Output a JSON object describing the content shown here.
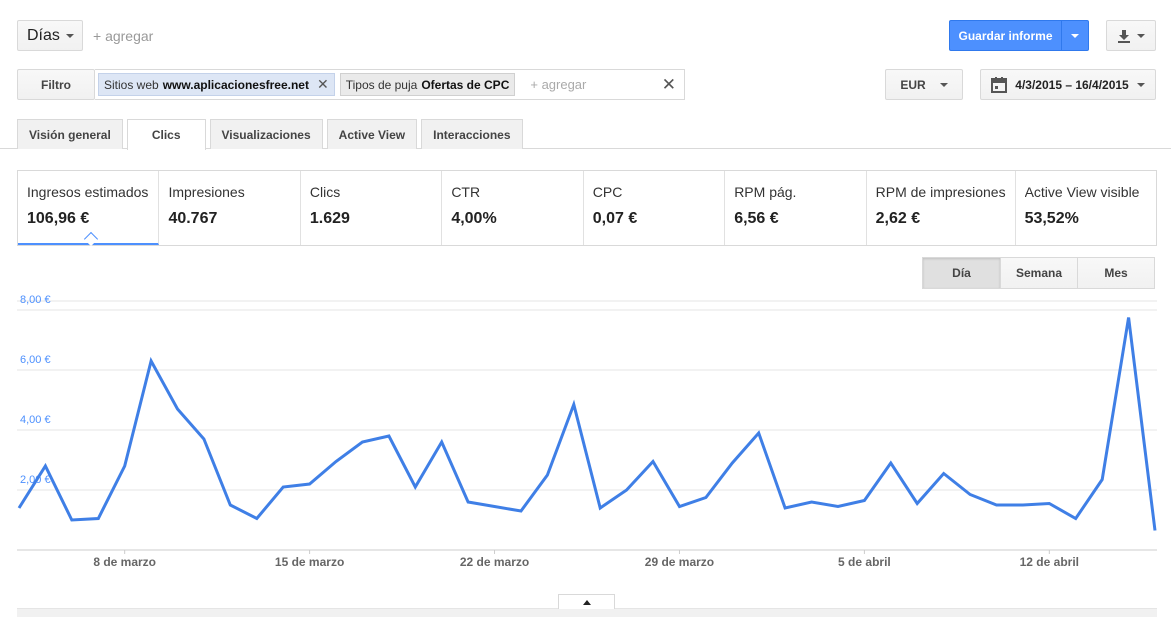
{
  "toolbar": {
    "period_label": "Días",
    "add_label": "+ agregar",
    "save_label": "Guardar informe"
  },
  "filters": {
    "filter_label": "Filtro",
    "chips": [
      {
        "key": "Sitios web",
        "value": "www.aplicacionesfree.net"
      },
      {
        "key": "Tipos de puja",
        "value": "Ofertas de CPC"
      }
    ],
    "add_label": "+ agregar",
    "currency": "EUR",
    "date_range": "4/3/2015 – 16/4/2015"
  },
  "tabs": [
    "Visión general",
    "Clics",
    "Visualizaciones",
    "Active View",
    "Interacciones"
  ],
  "metrics": [
    {
      "name": "Ingresos estimados",
      "value": "106,96 €"
    },
    {
      "name": "Impresiones",
      "value": "40.767"
    },
    {
      "name": "Clics",
      "value": "1.629"
    },
    {
      "name": "CTR",
      "value": "4,00%"
    },
    {
      "name": "CPC",
      "value": "0,07 €"
    },
    {
      "name": "RPM pág.",
      "value": "6,56 €"
    },
    {
      "name": "RPM de impresiones",
      "value": "2,62 €"
    },
    {
      "name": "Active View visible",
      "value": "53,52%"
    }
  ],
  "granularity": [
    "Día",
    "Semana",
    "Mes"
  ],
  "colors": {
    "accent": "#4d90fe",
    "line": "#3f7fe6"
  },
  "chart_data": {
    "type": "line",
    "x": [
      "2015-03-04",
      "2015-03-05",
      "2015-03-06",
      "2015-03-07",
      "2015-03-08",
      "2015-03-09",
      "2015-03-10",
      "2015-03-11",
      "2015-03-12",
      "2015-03-13",
      "2015-03-14",
      "2015-03-15",
      "2015-03-16",
      "2015-03-17",
      "2015-03-18",
      "2015-03-19",
      "2015-03-20",
      "2015-03-21",
      "2015-03-22",
      "2015-03-23",
      "2015-03-24",
      "2015-03-25",
      "2015-03-26",
      "2015-03-27",
      "2015-03-28",
      "2015-03-29",
      "2015-03-30",
      "2015-03-31",
      "2015-04-01",
      "2015-04-02",
      "2015-04-03",
      "2015-04-04",
      "2015-04-05",
      "2015-04-06",
      "2015-04-07",
      "2015-04-08",
      "2015-04-09",
      "2015-04-10",
      "2015-04-11",
      "2015-04-12",
      "2015-04-13",
      "2015-04-14",
      "2015-04-15",
      "2015-04-16"
    ],
    "series": [
      {
        "values": [
          1.4,
          2.8,
          1.0,
          1.05,
          2.8,
          6.3,
          4.7,
          3.7,
          1.5,
          1.05,
          2.1,
          2.2,
          2.95,
          3.6,
          3.8,
          2.1,
          3.6,
          1.6,
          1.45,
          1.3,
          2.5,
          4.85,
          1.4,
          2.0,
          2.95,
          1.45,
          1.75,
          2.9,
          3.9,
          1.4,
          1.6,
          1.45,
          1.65,
          2.9,
          1.55,
          2.55,
          1.85,
          1.5,
          1.5,
          1.55,
          1.05,
          2.35,
          7.75,
          0.65
        ]
      }
    ],
    "x_tick_labels": [
      "8 de marzo",
      "15 de marzo",
      "22 de marzo",
      "29 de marzo",
      "5 de abril",
      "12 de abril"
    ],
    "y_tick_labels": [
      "2,00 €",
      "4,00 €",
      "6,00 €",
      "8,00 €"
    ],
    "y_ticks": [
      2,
      4,
      6,
      8
    ],
    "ylim": [
      0,
      8
    ],
    "grid": true,
    "title": "",
    "xlabel": "",
    "ylabel": ""
  }
}
